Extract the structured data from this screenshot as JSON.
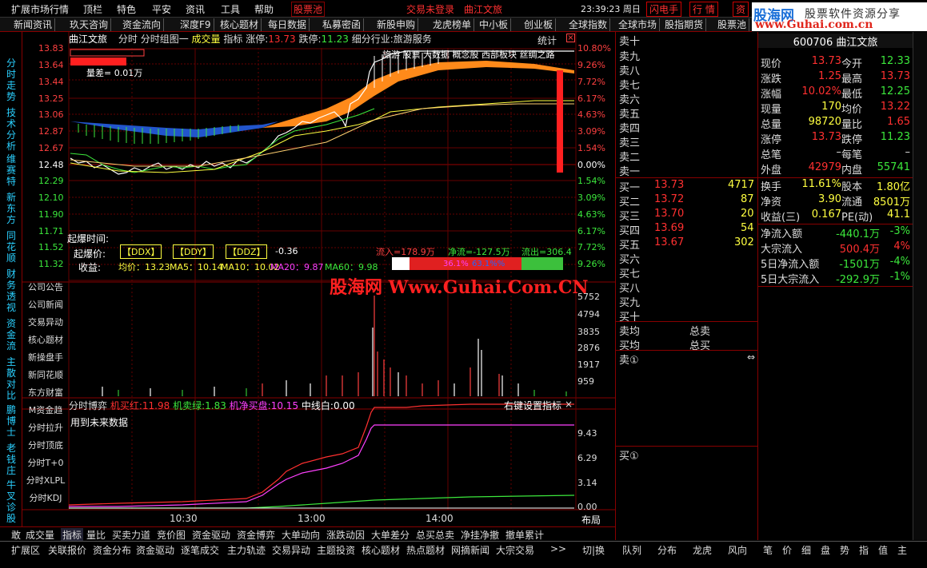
{
  "menu": {
    "items": [
      "扩展市场行情",
      "顶栏",
      "特色",
      "平安",
      "资讯",
      "工具",
      "帮助"
    ],
    "stock_pool": "股票池",
    "trade_status": "交易未登录",
    "stock_name": "曲江文旅",
    "clock": "23:39:23 周日",
    "flash": "闪电手",
    "quote": "行  情",
    "capital": "资"
  },
  "logo": {
    "text_cn": "股海网",
    "slogan": "股票软件资源分享",
    "url": "www.Guhai.com.cn"
  },
  "tabs": [
    "新闻资讯",
    "玖天咨询",
    "资金流向",
    "深度F9",
    "核心题材",
    "每日数据",
    "私募密函",
    "新股申购",
    "龙虎榜单",
    "中小板",
    "创业板",
    "全球指数",
    "全球市场",
    "股指期货",
    "股票池"
  ],
  "left_vtabs": [
    "分时走势",
    "技术分析",
    "维赛特",
    "新东方",
    "同花顺",
    "财务透视",
    "资金流",
    "主散对比",
    "鹏博士",
    "老钱庄",
    "牛叉诊股"
  ],
  "title_bar": {
    "name": "曲江文旅",
    "mode": "分时",
    "group": "分时组图一",
    "cjl": "成交量",
    "zb": "指标",
    "zt_label": "涨停:",
    "zt": "13.73",
    "dt_label": "跌停:",
    "dt": "11.23",
    "industry": "细分行业:旅游服务",
    "stat": "统计"
  },
  "price_labels": [
    "13.83",
    "13.64",
    "13.44",
    "13.25",
    "13.06",
    "12.87",
    "12.67",
    "12.48",
    "12.29",
    "12.10",
    "11.90",
    "11.71",
    "11.52",
    "11.32"
  ],
  "pct_labels": [
    "10.80%",
    "9.26%",
    "7.72%",
    "6.17%",
    "4.63%",
    "3.09%",
    "1.54%",
    "0.00%",
    "1.54%",
    "3.09%",
    "4.63%",
    "6.17%",
    "7.72%",
    "9.26%"
  ],
  "chart_overlay": {
    "diff": "量差= 0.01万",
    "qb_time": "起爆时间:",
    "qb_price": "起爆价:",
    "income": "收益:",
    "ddx": "【DDX】",
    "ddy": "【DDY】",
    "ddz": "【DDZ】",
    "ddz_val": "-0.36",
    "avg": "均价：13.23",
    "ma5": "MA5：10.14",
    "ma10": "MA10：10.02",
    "ma20": "MA20：9.87",
    "ma60": "MA60：9.98",
    "inflow": "流入=178.9万",
    "netflow": "净流=-127.5万",
    "outflow": "流出=306.4",
    "ratio1": "36.1%",
    "ratio2": "63.1%%",
    "news_text": "旅游 股票 大数据 概念股 西部板块 丝绸之路"
  },
  "indicator_buttons": [
    "公司公告",
    "公司新闻",
    "交易异动",
    "核心题材",
    "新操盘手",
    "新同花顺",
    "东方财富",
    "M资金趋",
    "分时拉升",
    "分时顶底",
    "分时T+0",
    "分时XLPL",
    "分时KDJ"
  ],
  "volume_labels": [
    "5752",
    "4794",
    "3835",
    "2876",
    "1917",
    "959"
  ],
  "sub_title": {
    "name": "分时博弈",
    "red_label": "机买红:",
    "red": "11.98",
    "green_label": "机卖绿:",
    "green": "1.83",
    "mag_label": "机净买盘:",
    "mag": "10.15",
    "mid_label": "中线白:",
    "mid": "0.00",
    "setting": "右键设置指标",
    "note": "用到未来数据"
  },
  "sub_labels": [
    "9.43",
    "6.29",
    "3.14",
    "0.00"
  ],
  "time_labels": [
    "10:30",
    "13:00",
    "14:00"
  ],
  "layout_btn": "布局",
  "order_book": {
    "sell": [
      "卖十",
      "卖九",
      "卖八",
      "卖七",
      "卖六",
      "卖五",
      "卖四",
      "卖三",
      "卖二",
      "卖一"
    ],
    "buy_labels": [
      "买一",
      "买二",
      "买三",
      "买四",
      "买五",
      "买六",
      "买七",
      "买八",
      "买九",
      "买十"
    ],
    "buy_prices": [
      "13.73",
      "13.72",
      "13.70",
      "13.69",
      "13.67"
    ],
    "buy_vols": [
      "4717",
      "87",
      "20",
      "54",
      "302"
    ],
    "avg_sell": "卖均",
    "avg_buy": "买均",
    "total_sell": "总卖",
    "total_buy": "总买",
    "sell_circle": "卖①",
    "buy_circle": "买①"
  },
  "quote": {
    "code": "600706",
    "name": "曲江文旅",
    "rows": [
      [
        "现价",
        "13.73",
        "今开",
        "12.33"
      ],
      [
        "涨跌",
        "1.25",
        "最高",
        "13.73"
      ],
      [
        "涨幅",
        "10.02%",
        "最低",
        "12.25"
      ],
      [
        "现量",
        "170",
        "均价",
        "13.22"
      ],
      [
        "总量",
        "98720",
        "量比",
        "1.65"
      ],
      [
        "涨停",
        "13.73",
        "跌停",
        "11.23"
      ],
      [
        "总笔",
        "–",
        "每笔",
        "–"
      ],
      [
        "外盘",
        "42979",
        "内盘",
        "55741"
      ]
    ],
    "rows2": [
      [
        "换手",
        "11.61%",
        "股本",
        "1.80亿"
      ],
      [
        "净资",
        "3.90",
        "流通",
        "8501万"
      ],
      [
        "收益(三)",
        "0.167",
        "PE(动)",
        "41.1"
      ]
    ],
    "flow": [
      [
        "净流入额",
        "-440.1万",
        "-3%"
      ],
      [
        "大宗流入",
        "500.4万",
        "4%"
      ],
      [
        "5日净流入额",
        "-1501万",
        "-4%"
      ],
      [
        "5日大宗流入",
        "-292.9万",
        "-1%"
      ]
    ]
  },
  "bottom_tabs": [
    "敢",
    "成交量",
    "指标",
    "量比",
    "买卖力道",
    "竞价图",
    "资金驱动",
    "资金博弈",
    "大单动向",
    "涨跌动因",
    "大单差分",
    "总买总卖",
    "净挂净撤",
    "撤单累计"
  ],
  "footer_tabs": [
    "扩展区",
    "关联报价",
    "资金分布",
    "资金驱动",
    "逐笔成交",
    "主力轨迹",
    "交易异动",
    "主题投资",
    "核心题材",
    "热点题材",
    "网摘新闻",
    "大宗交易",
    ">>",
    "切|换"
  ],
  "footer_right": [
    "队列",
    "分布",
    "龙虎",
    "风向"
  ],
  "footer_far": [
    "笔",
    "价",
    "细",
    "盘",
    "势",
    "指",
    "值",
    "主"
  ]
}
